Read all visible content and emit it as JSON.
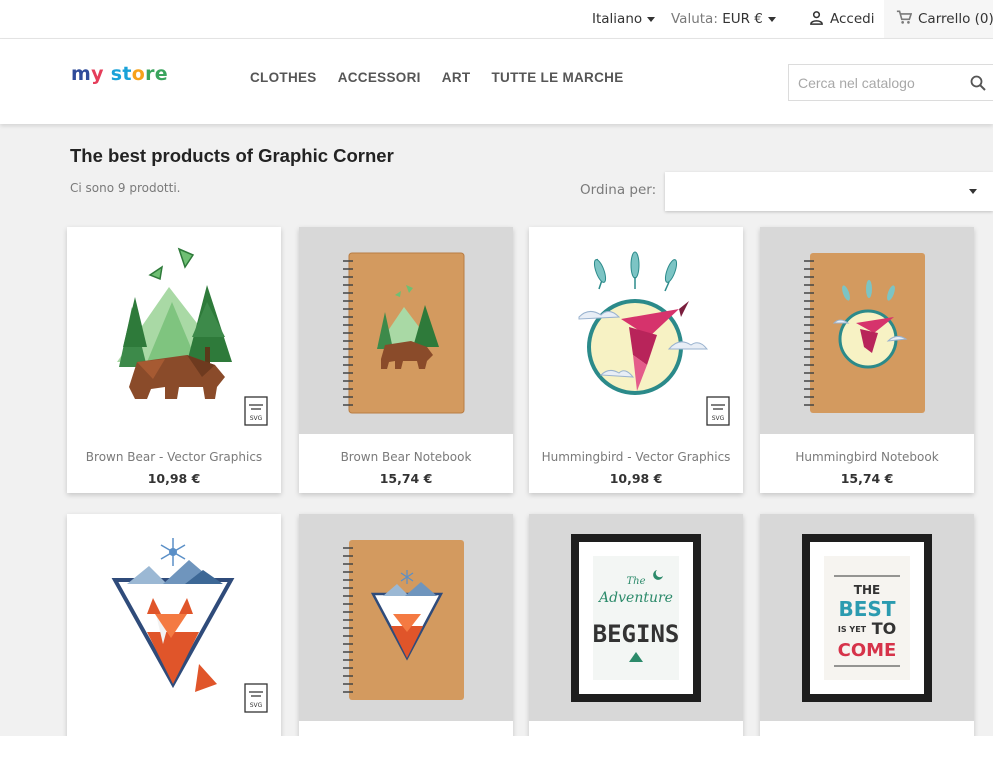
{
  "topbar": {
    "language": "Italiano",
    "currency_label": "Valuta:",
    "currency_value": "EUR €",
    "login_label": "Accedi",
    "cart_label": "Carrello",
    "cart_count": "(0)"
  },
  "header": {
    "logo": {
      "part1": "m",
      "part2": "y ",
      "part3": "st",
      "part4": "o",
      "part5": "re"
    },
    "nav": [
      "CLOTHES",
      "ACCESSORI",
      "ART",
      "TUTTE LE MARCHE"
    ],
    "search_placeholder": "Cerca nel catalogo"
  },
  "listing": {
    "title": "The best products of Graphic Corner",
    "count_text": "Ci sono 9 prodotti.",
    "sort_label": "Ordina per:",
    "sort_value": ""
  },
  "products": [
    {
      "name": "Brown Bear - Vector Graphics",
      "price": "10,98 €"
    },
    {
      "name": "Brown Bear Notebook",
      "price": "15,74 €"
    },
    {
      "name": "Hummingbird - Vector Graphics",
      "price": "10,98 €"
    },
    {
      "name": "Hummingbird Notebook",
      "price": "15,74 €"
    }
  ],
  "poster_texts": {
    "adventure_line1": "The",
    "adventure_line2": "Adventure",
    "adventure_line3": "BEGINS",
    "best_line1": "THE",
    "best_line2": "BEST",
    "best_line3": "IS YET",
    "best_line4": "TO",
    "best_line5": "COME"
  },
  "badges": {
    "svg": "SVG"
  },
  "colors": {
    "accent_blue": "#2fb5d2",
    "kraft": "#d39a5f",
    "bear_brown": "#8a4b2a",
    "forest_green": "#3d8a4a",
    "hummingbird_pink": "#d6336c",
    "teal": "#2b8a8a",
    "fox_orange": "#e0552a"
  },
  "icons": [
    "chevron-down-icon",
    "user-icon",
    "shopping-cart-icon",
    "search-icon",
    "svg-file-icon"
  ]
}
